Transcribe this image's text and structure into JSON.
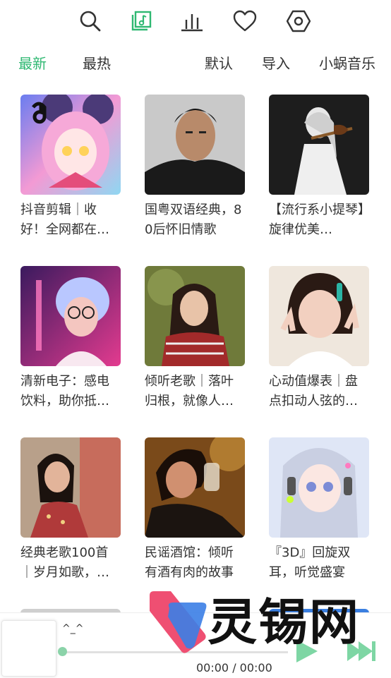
{
  "topbar": {
    "icons": [
      "search-icon",
      "music-library-icon",
      "bar-chart-icon",
      "heart-icon",
      "hexagon-settings-icon"
    ],
    "accent": "#2fb872",
    "icon_color": "#333333"
  },
  "filters": {
    "latest": "最新",
    "hottest": "最热",
    "default": "默认",
    "import": "导入",
    "source": "小蜗音乐"
  },
  "playlists": [
    {
      "title": "抖音剪辑｜收好！全网都在…"
    },
    {
      "title": "国粤双语经典，80后怀旧情歌"
    },
    {
      "title": "【流行系小提琴】旋律优美…"
    },
    {
      "title": "清新电子：感电饮料，助你抵…"
    },
    {
      "title": "倾听老歌｜落叶归根，就像人…"
    },
    {
      "title": "心动值爆表｜盘点扣动人弦的…"
    },
    {
      "title": "经典老歌100首｜岁月如歌，…"
    },
    {
      "title": "民谣酒馆：倾听有酒有肉的故事"
    },
    {
      "title": "『3D』回旋双耳，听觉盛宴"
    }
  ],
  "player": {
    "song": "^_^",
    "time": "00:00 / 00:00",
    "progress": 0
  },
  "watermark": {
    "text": "灵锡网"
  }
}
